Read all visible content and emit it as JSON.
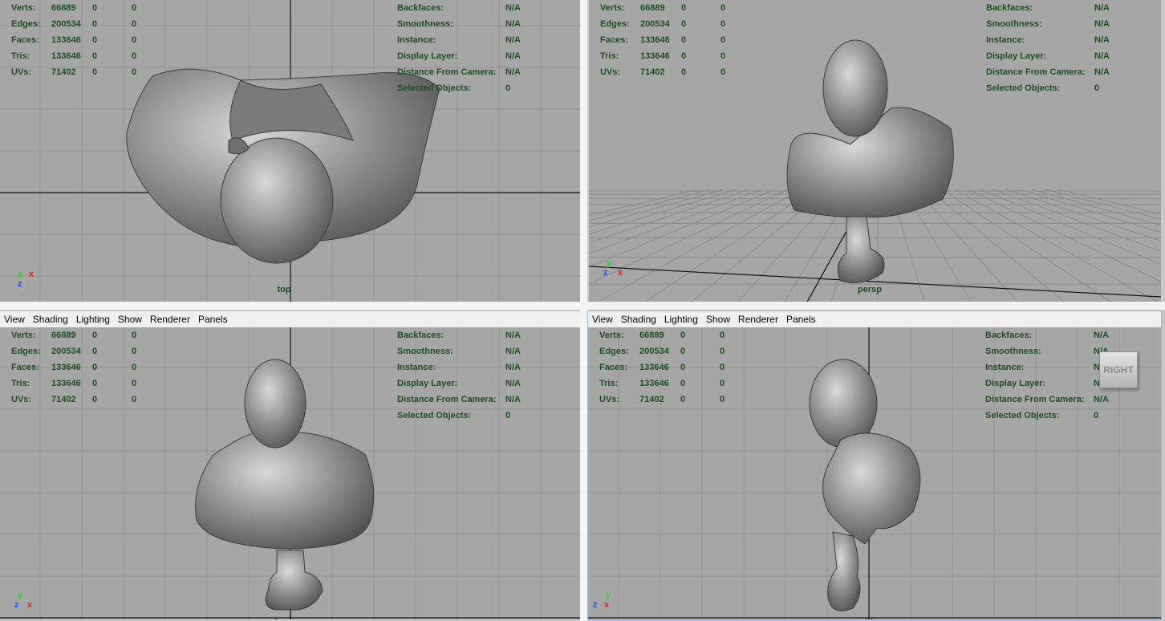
{
  "menu": [
    "View",
    "Shading",
    "Lighting",
    "Show",
    "Renderer",
    "Panels"
  ],
  "stats": {
    "rows": [
      {
        "label": "Verts:",
        "total": "66889",
        "sel": "0",
        "comp": "0"
      },
      {
        "label": "Edges:",
        "total": "200534",
        "sel": "0",
        "comp": "0"
      },
      {
        "label": "Faces:",
        "total": "133646",
        "sel": "0",
        "comp": "0"
      },
      {
        "label": "Tris:",
        "total": "133646",
        "sel": "0",
        "comp": "0"
      },
      {
        "label": "UVs:",
        "total": "71402",
        "sel": "0",
        "comp": "0"
      }
    ],
    "info": [
      {
        "label": "Backfaces:",
        "value": "N/A"
      },
      {
        "label": "Smoothness:",
        "value": "N/A"
      },
      {
        "label": "Instance:",
        "value": "N/A"
      },
      {
        "label": "Display Layer:",
        "value": "N/A"
      },
      {
        "label": "Distance From Camera:",
        "value": "N/A"
      },
      {
        "label": "Selected Objects:",
        "value": "0"
      }
    ]
  },
  "viewports": [
    {
      "id": "top",
      "camera": "top",
      "menu": false,
      "axes": [
        "y",
        "x",
        "z"
      ]
    },
    {
      "id": "persp",
      "camera": "persp",
      "menu": false,
      "axes": [
        "y",
        "z",
        "x"
      ]
    },
    {
      "id": "front",
      "camera": "front",
      "menu": true,
      "axes": [
        "y",
        "z",
        "x"
      ]
    },
    {
      "id": "side",
      "camera": "side",
      "menu": true,
      "axes": [
        "y",
        "z",
        "x"
      ],
      "viewcube": "RIGHT"
    }
  ],
  "colors": {
    "viewport_bg": "#a6a6a6",
    "hud_text": "#1e4f1e",
    "axis_y": "#2bd22b",
    "axis_x": "#e02020",
    "axis_z": "#2050f0"
  }
}
